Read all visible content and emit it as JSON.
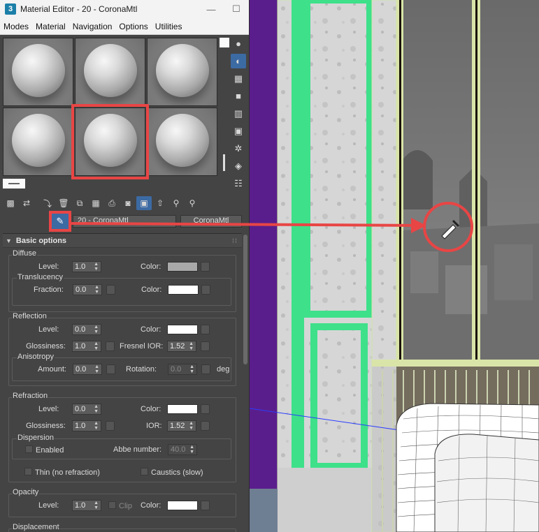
{
  "window": {
    "app_icon": "3",
    "title": "Material Editor - 20 - CoronaMtl",
    "minimize": "—",
    "maximize": "☐",
    "close": "✕"
  },
  "menu": [
    "Modes",
    "Material",
    "Navigation",
    "Options",
    "Utilities"
  ],
  "slots": {
    "count": 6,
    "selected_index": 4
  },
  "name_row": {
    "material_name": "20 - CoronaMtl",
    "material_type": "CoronaMtl"
  },
  "rollout": {
    "title": "Basic options"
  },
  "diffuse": {
    "title": "Diffuse",
    "level_label": "Level:",
    "level": "1.0",
    "color_label": "Color:",
    "color": "#a9a9a9",
    "translucency_title": "Translucency",
    "fraction_label": "Fraction:",
    "fraction": "0.0",
    "trans_color_label": "Color:",
    "trans_color": "#ffffff"
  },
  "reflection": {
    "title": "Reflection",
    "level_label": "Level:",
    "level": "0.0",
    "color_label": "Color:",
    "color": "#ffffff",
    "glossiness_label": "Glossiness:",
    "glossiness": "1.0",
    "fresnel_label": "Fresnel IOR:",
    "fresnel": "1.52",
    "anisotropy_title": "Anisotropy",
    "amount_label": "Amount:",
    "amount": "0.0",
    "rotation_label": "Rotation:",
    "rotation": "0.0",
    "deg_label": "deg"
  },
  "refraction": {
    "title": "Refraction",
    "level_label": "Level:",
    "level": "0.0",
    "color_label": "Color:",
    "color": "#ffffff",
    "glossiness_label": "Glossiness:",
    "glossiness": "1.0",
    "ior_label": "IOR:",
    "ior": "1.52",
    "dispersion_title": "Dispersion",
    "enabled_label": "Enabled",
    "abbe_label": "Abbe number:",
    "abbe": "40.0",
    "thin_label": "Thin (no refraction)",
    "caustics_label": "Caustics (slow)"
  },
  "opacity": {
    "title": "Opacity",
    "level_label": "Level:",
    "level": "1.0",
    "clip_label": "Clip",
    "color_label": "Color:",
    "color": "#ffffff"
  },
  "displacement": {
    "title": "Displacement"
  },
  "colors": {
    "highlight": "#e84545",
    "active_tool": "#3c6aa3",
    "viewport_bg": "#5a1e8c",
    "trim_green": "#3ee08a"
  }
}
